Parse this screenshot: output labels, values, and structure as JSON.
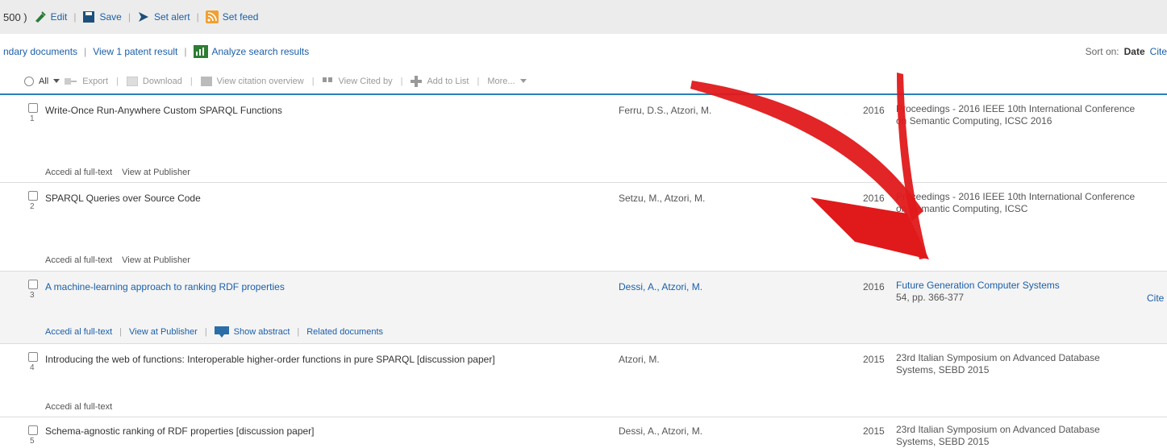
{
  "topbar": {
    "count": "500 )",
    "edit": "Edit",
    "save": "Save",
    "set_alert": "Set alert",
    "set_feed": "Set feed",
    "sep": "|"
  },
  "secondary": {
    "secondary_docs": "ndary documents",
    "patent": "View 1 patent result",
    "analyze": "Analyze search results",
    "sep": "|",
    "sort_label": "Sort on:",
    "sort_value": "Date",
    "sort_next": "Cite"
  },
  "toolbar": {
    "all": "All",
    "export": "Export",
    "download": "Download",
    "citation_overview": "View citation overview",
    "cited_by": "View Cited by",
    "add_to_list": "Add to List",
    "more": "More...",
    "sep": "|"
  },
  "results": [
    {
      "num": "1",
      "title": "Write-Once Run-Anywhere Custom SPARQL Functions",
      "authors": "Ferru, D.S., Atzori, M.",
      "year": "2016",
      "source": "Proceedings - 2016 IEEE 10th International Conference on Semantic Computing, ICSC 2016",
      "actions": [
        "Accedi al full-text",
        "View at Publisher"
      ]
    },
    {
      "num": "2",
      "title": "SPARQL Queries over Source Code",
      "authors": "Setzu, M., Atzori, M.",
      "year": "2016",
      "source": "Proceedings - 2016 IEEE 10th International Conference on Semantic Computing, ICSC",
      "actions": [
        "Accedi al full-text",
        "View at Publisher"
      ]
    },
    {
      "num": "3",
      "title": "A machine-learning approach to ranking RDF properties",
      "authors": "Dessi, A., Atzori, M.",
      "year": "2016",
      "source": "Future Generation Computer Systems",
      "source_detail": "54, pp. 366-377",
      "cite": "Cite",
      "actions": [
        "Accedi al full-text",
        "View at Publisher",
        "Show abstract",
        "Related documents"
      ]
    },
    {
      "num": "4",
      "title": "Introducing the web of functions: Interoperable higher-order functions in pure SPARQL [discussion paper]",
      "authors": "Atzori, M.",
      "year": "2015",
      "source": "23rd Italian Symposium on Advanced Database Systems, SEBD 2015",
      "actions": [
        "Accedi al full-text"
      ]
    },
    {
      "num": "5",
      "title": "Schema-agnostic ranking of RDF properties [discussion paper]",
      "authors": "Dessi, A., Atzori, M.",
      "year": "2015",
      "source": "23rd Italian Symposium on Advanced Database Systems, SEBD 2015"
    }
  ],
  "colors": {
    "link": "#1b5fa8",
    "arrow": "#e0191b",
    "toolbar_rule": "#2a7fb8",
    "rss": "#f0a030",
    "analyze_icon": "#2e7d32"
  },
  "icons": [
    "edit-icon",
    "save-icon",
    "alert-icon",
    "rss-feed-icon",
    "analyze-icon",
    "export-icon",
    "download-icon",
    "citation-overview-icon",
    "cited-by-icon",
    "add-to-list-icon",
    "chevron-down-icon",
    "show-abstract-icon"
  ]
}
